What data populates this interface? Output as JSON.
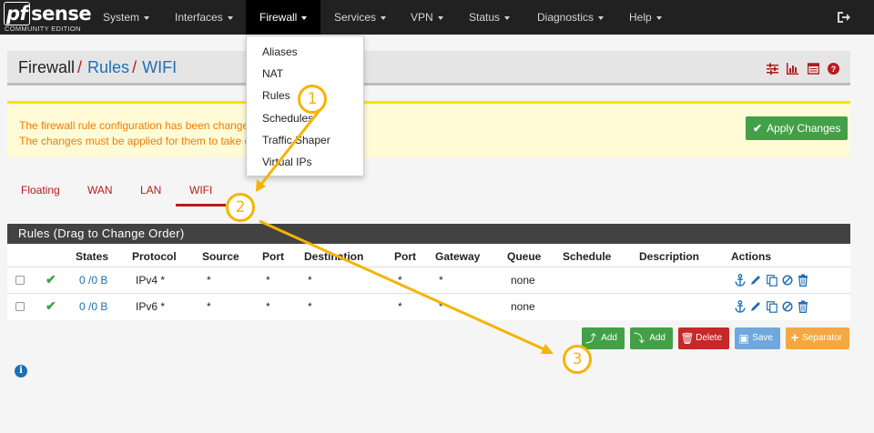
{
  "brand": {
    "logo_main": "pfsense",
    "logo_sub": "COMMUNITY EDITION"
  },
  "nav": {
    "items": [
      {
        "label": "System"
      },
      {
        "label": "Interfaces"
      },
      {
        "label": "Firewall"
      },
      {
        "label": "Services"
      },
      {
        "label": "VPN"
      },
      {
        "label": "Status"
      },
      {
        "label": "Diagnostics"
      },
      {
        "label": "Help"
      }
    ],
    "active": "Firewall",
    "logout_icon": "logout-icon"
  },
  "dropdown": {
    "items": [
      "Aliases",
      "NAT",
      "Rules",
      "Schedules",
      "Traffic Shaper",
      "Virtual IPs"
    ]
  },
  "breadcrumb": {
    "root": "Firewall",
    "sep": "/",
    "level1": "Rules",
    "level2": "WIFI"
  },
  "header_icons": [
    "sliders-icon",
    "bar-chart-icon",
    "list-table-icon",
    "help-circle-icon"
  ],
  "warning": {
    "line1": "The firewall rule configuration has been changed.",
    "line2": "The changes must be applied for them to take effe",
    "apply_label": "Apply Changes"
  },
  "tabs": [
    {
      "label": "Floating"
    },
    {
      "label": "WAN"
    },
    {
      "label": "LAN"
    },
    {
      "label": "WIFI"
    }
  ],
  "active_tab": "WIFI",
  "rules": {
    "heading": "Rules (Drag to Change Order)",
    "columns": [
      "States",
      "Protocol",
      "Source",
      "Port",
      "Destination",
      "Port",
      "Gateway",
      "Queue",
      "Schedule",
      "Description",
      "Actions"
    ],
    "rows": [
      {
        "states": "0 /0 B",
        "protocol": "IPv4 *",
        "source": "*",
        "port": "*",
        "destination": "*",
        "dport": "*",
        "gateway": "*",
        "queue": "none",
        "schedule": "",
        "description": ""
      },
      {
        "states": "0 /0 B",
        "protocol": "IPv6 *",
        "source": "*",
        "port": "*",
        "destination": "*",
        "dport": "*",
        "gateway": "*",
        "queue": "none",
        "schedule": "",
        "description": ""
      }
    ]
  },
  "buttons": {
    "add_top": "Add",
    "add_bottom": "Add",
    "delete": "Delete",
    "save": "Save",
    "separator": "Separator"
  },
  "annotations": [
    "1",
    "2",
    "3"
  ],
  "colors": {
    "navbar": "#212121",
    "accent_red": "#b71c1c",
    "link_blue": "#1e6fb6",
    "success_green": "#43a047",
    "danger_red": "#c62828",
    "save_blue": "#6fa8dc",
    "warning_orange": "#f57c00",
    "annotation_yellow": "#f5b400"
  }
}
